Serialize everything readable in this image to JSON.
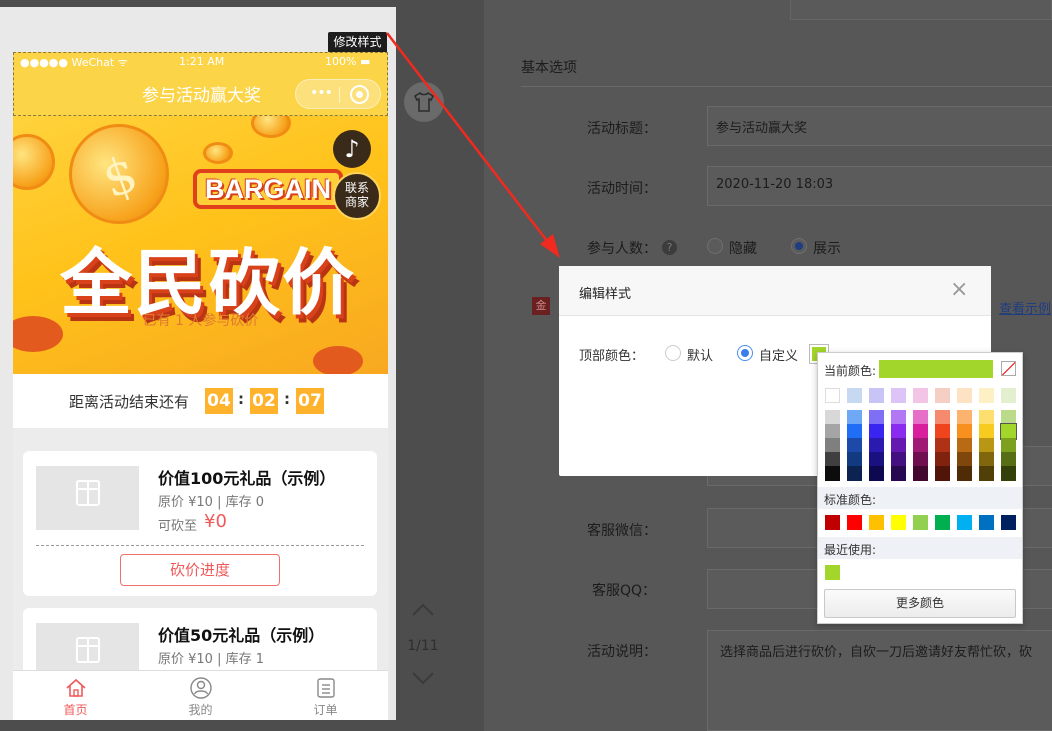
{
  "phone": {
    "status": {
      "carrier": "●●●●● WeChat ᯤ",
      "time": "1:21 AM",
      "battery": "100% ▬"
    },
    "nav_title": "参与活动赢大奖",
    "capsule_more": "•••",
    "banner": {
      "bargain_text": "BARGAIN",
      "title": "全民砍价",
      "participants": "已有 1 人参与砍价",
      "music_icon": "music-note-icon",
      "music_glyph": "♪",
      "contact_line1": "联系",
      "contact_line2": "商家"
    },
    "countdown": {
      "label": "距离活动结束还有",
      "hours": "04",
      "minutes": "02",
      "seconds": "07",
      "sep": ":"
    },
    "cards": [
      {
        "title": "价值100元礼品（示例）",
        "meta": "原价 ¥10 | 库存 0",
        "cut_label": "可砍至",
        "cut_value": "¥0",
        "button": "砍价进度"
      },
      {
        "title": "价值50元礼品（示例）",
        "meta": "原价 ¥10 | 库存 1"
      }
    ],
    "tabs": [
      {
        "label": "首页",
        "icon": "home-icon",
        "active": true
      },
      {
        "label": "我的",
        "icon": "user-icon",
        "active": false
      },
      {
        "label": "订单",
        "icon": "order-icon",
        "active": false
      }
    ]
  },
  "tooltip": "修改样式",
  "gutter": {
    "shirt_icon": "tshirt-icon",
    "page_counter": "1/11"
  },
  "form": {
    "section_title": "基本选项",
    "activity_title_label": "活动标题：",
    "activity_title_value": "参与活动赢大奖",
    "activity_time_label": "活动时间：",
    "activity_time_value": "2020-11-20 18:03",
    "participants_label": "参与人数：",
    "help_glyph": "?",
    "hide_option": "隐藏",
    "show_option": "展示",
    "gold_badge": "金",
    "view_example": "查看示例",
    "wechat_label": "客服微信：",
    "qq_label": "客服QQ：",
    "desc_label": "活动说明：",
    "desc_value": "选择商品后进行砍价，自砍一刀后邀请好友帮忙砍，砍"
  },
  "modal": {
    "title": "编辑样式",
    "close_glyph": "×",
    "top_color_label": "顶部颜色：",
    "default_option": "默认",
    "custom_option": "自定义",
    "current_color": "#a3d62a"
  },
  "picker": {
    "current_label": "当前颜色:",
    "standard_label": "标准颜色:",
    "recent_label": "最近使用:",
    "more_button": "更多颜色",
    "theme_columns": [
      [
        "#ffffff",
        "#d8d8d8",
        "#a5a5a5",
        "#7f7f7f",
        "#3f3f3f",
        "#0c0c0c"
      ],
      [
        "#c6d9f1",
        "#6fa8f5",
        "#1f6ef5",
        "#1d4aa8",
        "#123a80",
        "#0c2250"
      ],
      [
        "#c9c4f6",
        "#7e6ff5",
        "#3a25f0",
        "#2a1ab0",
        "#1b1080",
        "#0e0850"
      ],
      [
        "#dcc4f6",
        "#b177f5",
        "#8a2bf0",
        "#6419b0",
        "#440f80",
        "#280850"
      ],
      [
        "#f2c4e6",
        "#e66fc8",
        "#d81f9e",
        "#a01975",
        "#700f50",
        "#420830"
      ],
      [
        "#f6cfc4",
        "#f58a6f",
        "#f0441f",
        "#b03216",
        "#80220e",
        "#501408"
      ],
      [
        "#fde2c4",
        "#fcb36f",
        "#f7901f",
        "#b96a14",
        "#80470c",
        "#502c06"
      ],
      [
        "#fdf0c4",
        "#fcdf6f",
        "#f7cb1f",
        "#b99614",
        "#80660c",
        "#503f06"
      ],
      [
        "#e3efcf",
        "#bcdb8a",
        "#a3d62a",
        "#7da11f",
        "#576e14",
        "#33400a"
      ]
    ],
    "standard_colors": [
      "#c00000",
      "#ff0000",
      "#ffc000",
      "#ffff00",
      "#92d050",
      "#00b050",
      "#00b0f0",
      "#0070c0",
      "#002060"
    ],
    "recent_colors": [
      "#a3d62a"
    ]
  }
}
